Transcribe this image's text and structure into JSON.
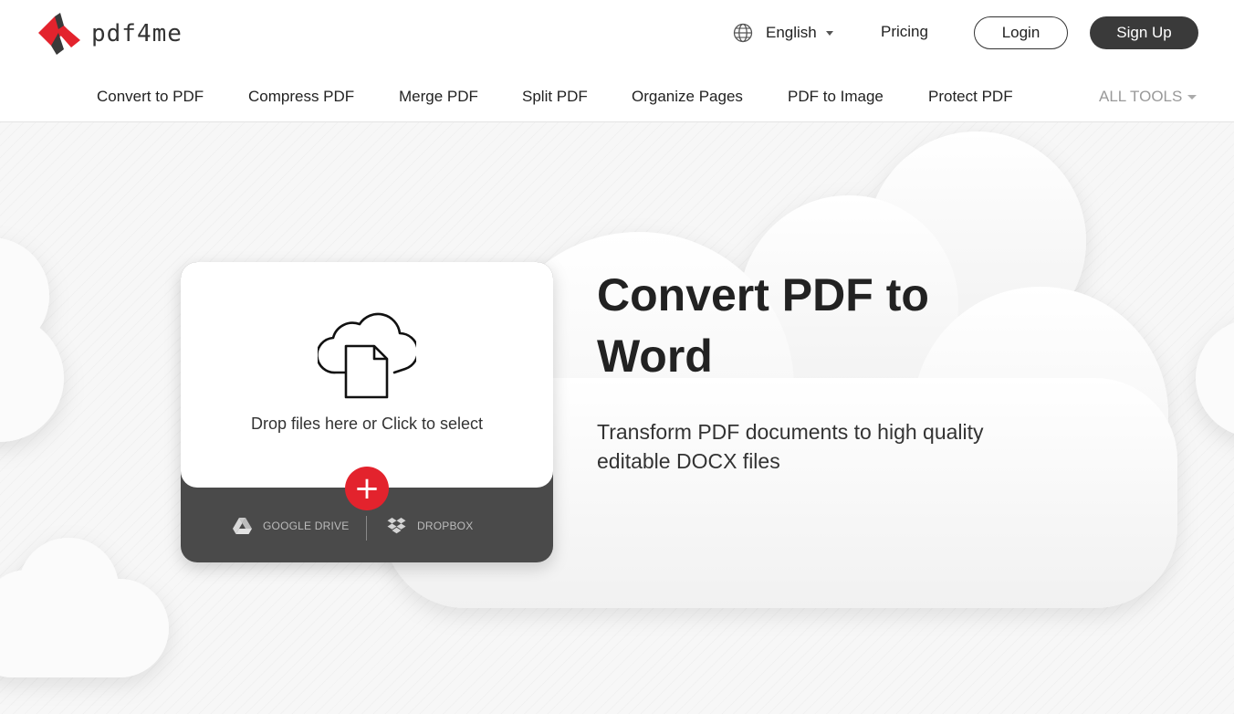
{
  "brand": {
    "name": "pdf4me",
    "red": "#e3232d",
    "dark": "#3a3a3a"
  },
  "header": {
    "language": "English",
    "pricing": "Pricing",
    "login": "Login",
    "signup": "Sign Up"
  },
  "toolnav": {
    "items": [
      "Convert to PDF",
      "Compress PDF",
      "Merge PDF",
      "Split PDF",
      "Organize Pages",
      "PDF to Image",
      "Protect PDF"
    ],
    "all_tools": "ALL TOOLS"
  },
  "upload": {
    "drop_text": "Drop files here or Click to select",
    "add_symbol": "+",
    "google_drive": "GOOGLE DRIVE",
    "dropbox": "DROPBOX"
  },
  "hero": {
    "title_line1": "Convert PDF to",
    "title_line2": "Word",
    "subtitle_line1": "Transform PDF documents to high quality",
    "subtitle_line2": "editable DOCX files"
  },
  "icons": {
    "globe": "globe-icon",
    "upload": "cloud-upload-icon",
    "google_drive": "google-drive-icon",
    "dropbox": "dropbox-icon"
  }
}
